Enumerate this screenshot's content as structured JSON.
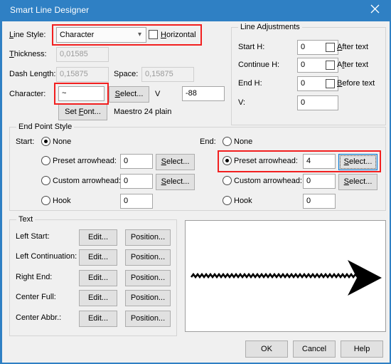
{
  "window": {
    "title": "Smart Line Designer",
    "close_icon": "close-icon",
    "accent_color": "#2f80c4",
    "background_color": "#f0f0f0"
  },
  "line_style": {
    "label": "Line Style:",
    "value": "Character",
    "dropdown_icon": "chevron-down-icon",
    "horizontal": {
      "label": "Horizontal",
      "checked": false
    }
  },
  "thickness": {
    "label": "Thickness:",
    "value": "0,01585",
    "enabled": false
  },
  "dash": {
    "length_label": "Dash Length:",
    "length_value": "0,15875",
    "space_label": "Space:",
    "space_value": "0,15875",
    "enabled": false
  },
  "character": {
    "label": "Character:",
    "value": "~",
    "select_label": "Select...",
    "v_label": "V",
    "v_value": "-88",
    "set_font_label": "Set Font...",
    "font_description": "Maestro 24 plain"
  },
  "line_adjustments": {
    "title": "Line Adjustments",
    "rows": [
      {
        "label": "Start H:",
        "value": "0",
        "check_label": "After text",
        "checked": false
      },
      {
        "label": "Continue H:",
        "value": "0",
        "check_label": "After text",
        "checked": false
      },
      {
        "label": "End H:",
        "value": "0",
        "check_label": "Before text",
        "checked": false
      },
      {
        "label": "V:",
        "value": "0",
        "check_label": "",
        "checked": false
      }
    ]
  },
  "end_point_style": {
    "title": "End Point Style",
    "start": {
      "label": "Start:",
      "none_label": "None",
      "none_selected": true,
      "preset_label": "Preset arrowhead:",
      "preset_value": "0",
      "preset_selected": false,
      "preset_select_label": "Select...",
      "custom_label": "Custom arrowhead:",
      "custom_value": "0",
      "custom_selected": false,
      "custom_select_label": "Select...",
      "hook_label": "Hook",
      "hook_value": "0",
      "hook_selected": false
    },
    "end": {
      "label": "End:",
      "none_label": "None",
      "none_selected": false,
      "preset_label": "Preset arrowhead:",
      "preset_value": "4",
      "preset_selected": true,
      "preset_select_label": "Select...",
      "custom_label": "Custom arrowhead:",
      "custom_value": "0",
      "custom_selected": false,
      "custom_select_label": "Select...",
      "hook_label": "Hook",
      "hook_value": "0",
      "hook_selected": false
    }
  },
  "text_group": {
    "title": "Text",
    "rows": [
      {
        "label": "Left Start:",
        "edit_label": "Edit...",
        "position_label": "Position..."
      },
      {
        "label": "Left Continuation:",
        "edit_label": "Edit...",
        "position_label": "Position..."
      },
      {
        "label": "Right End:",
        "edit_label": "Edit...",
        "position_label": "Position..."
      },
      {
        "label": "Center Full:",
        "edit_label": "Edit...",
        "position_label": "Position..."
      },
      {
        "label": "Center Abbr.:",
        "edit_label": "Edit...",
        "position_label": "Position..."
      }
    ]
  },
  "preview": {
    "name": "line-preview",
    "description": "zigzag line with solid arrowhead at right end",
    "line_color": "#000000"
  },
  "footer": {
    "ok_label": "OK",
    "cancel_label": "Cancel",
    "help_label": "Help"
  },
  "highlights": [
    {
      "name": "line-style-highlight"
    },
    {
      "name": "character-field-highlight"
    },
    {
      "name": "end-preset-arrowhead-highlight"
    }
  ]
}
